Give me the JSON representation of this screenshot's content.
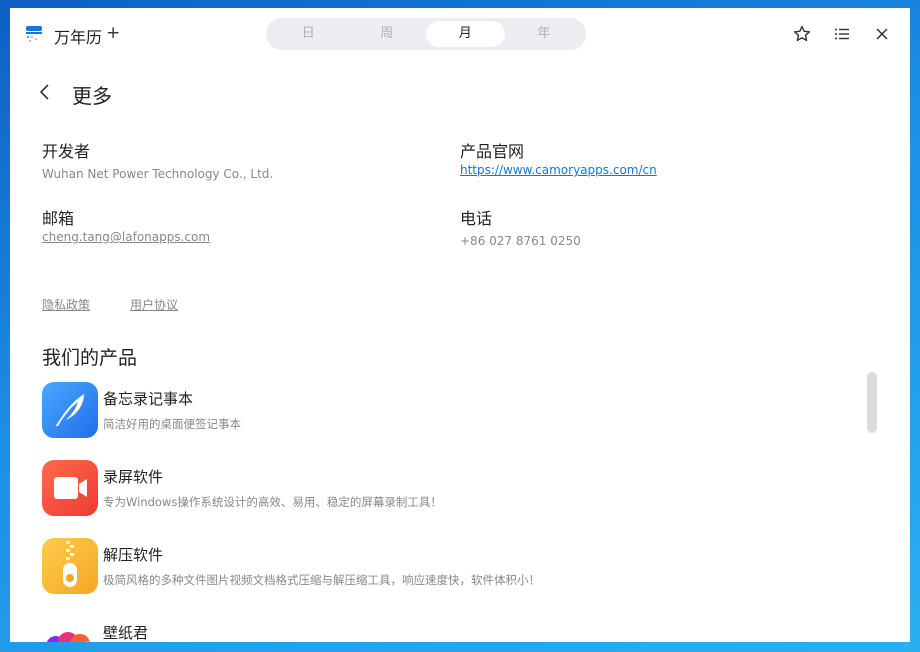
{
  "app": {
    "title": "万年历",
    "add_label": "+"
  },
  "view_tabs": [
    {
      "label": "日",
      "active": false
    },
    {
      "label": "周",
      "active": false
    },
    {
      "label": "月",
      "active": true
    },
    {
      "label": "年",
      "active": false
    }
  ],
  "toolbar_icons": [
    "star-icon",
    "list-icon",
    "close-icon"
  ],
  "page": {
    "title": "更多"
  },
  "info": {
    "developer": {
      "label": "开发者",
      "value": "Wuhan Net Power Technology Co., Ltd."
    },
    "website": {
      "label": "产品官网",
      "value": "https://www.camoryapps.com/cn"
    },
    "email": {
      "label": "邮箱",
      "value": "cheng.tang@lafonapps.com"
    },
    "phone": {
      "label": "电话",
      "value": "+86 027 8761 0250"
    }
  },
  "links": {
    "privacy": "隐私政策",
    "agreement": "用户协议"
  },
  "products": {
    "section_title": "我们的产品",
    "items": [
      {
        "name": "备忘录记事本",
        "desc": "简洁好用的桌面便签记事本",
        "icon": "feather-icon"
      },
      {
        "name": "录屏软件",
        "desc": "专为Windows操作系统设计的高效、易用、稳定的屏幕录制工具！",
        "icon": "video-camera-icon"
      },
      {
        "name": "解压软件",
        "desc": "极简风格的多种文件图片视频文档格式压缩与解压缩工具，响应速度快，软件体积小！",
        "icon": "zipper-icon"
      },
      {
        "name": "壁纸君",
        "desc": "",
        "icon": "hearts-icon"
      }
    ]
  },
  "colors": {
    "accent": "#1a73d9",
    "memo_icon": "#2b7ff0",
    "recorder_icon": "#f24b3c",
    "unzip_icon": "#f7b52c",
    "wallpaper_icon": "#e5317c"
  }
}
